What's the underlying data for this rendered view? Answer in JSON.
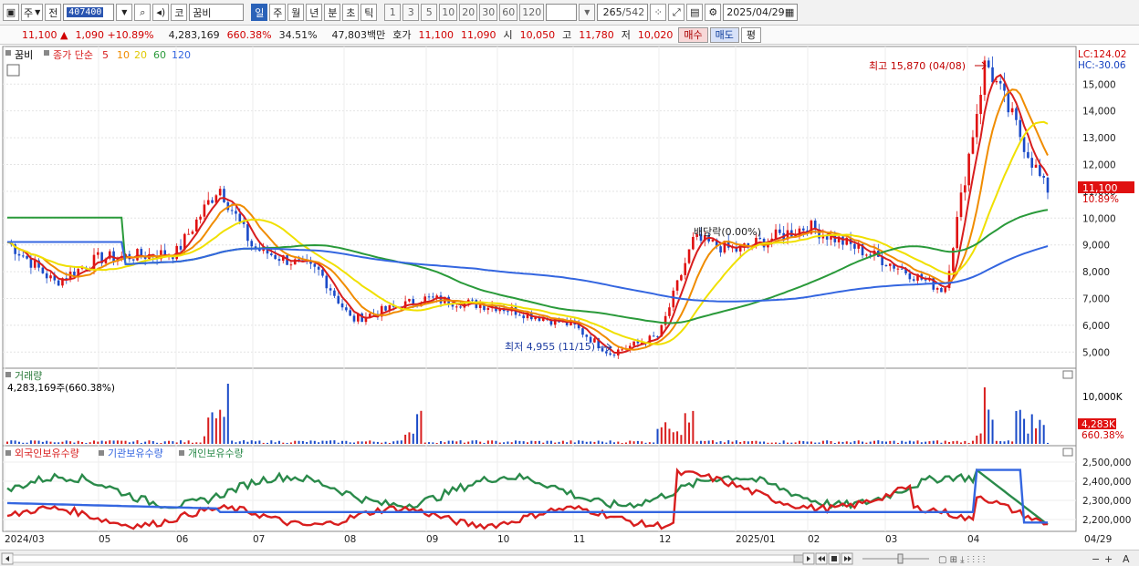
{
  "toolbar": {
    "type_label": "주",
    "prev_label": "전",
    "code": "407400",
    "market_label": "코",
    "stock_name": "꿈비",
    "periods": [
      "일",
      "주",
      "월",
      "년",
      "분",
      "초",
      "틱"
    ],
    "active_period": "일",
    "intervals": [
      "1",
      "3",
      "5",
      "10",
      "20",
      "30",
      "60",
      "120"
    ],
    "count": "265",
    "total": "/542",
    "date": "2025/04/29"
  },
  "quote": {
    "price": "11,100",
    "arrow": "▲",
    "change": "1,090",
    "change_pct": "+10.89%",
    "volume": "4,283,169",
    "volume_pct": "660.38%",
    "turnover": "34.51%",
    "amount": "47,803백만",
    "ask_label": "호가",
    "ask": "11,100",
    "bid": "11,090",
    "open_label": "시",
    "open": "10,050",
    "high_label": "고",
    "high": "11,780",
    "low_label": "저",
    "low": "10,020",
    "buy_label": "매수",
    "sell_label": "매도",
    "eval_label": "평"
  },
  "chart_data": {
    "type": "line",
    "stock": "꿈비",
    "legend_price": "종가 단순",
    "ma_periods": [
      "5",
      "10",
      "20",
      "60",
      "120"
    ],
    "ma_colors": [
      "#d81e1e",
      "#f08c00",
      "#f0e000",
      "#2a9a3a",
      "#3466e0"
    ],
    "price_ticks": [
      "15,000",
      "14,000",
      "13,000",
      "12,000",
      "11,000",
      "10,000",
      "9,000",
      "8,000",
      "7,000",
      "6,000",
      "5,000"
    ],
    "price_range": [
      4500,
      16200
    ],
    "lc_label": "LC:124.02",
    "hc_label": "HC:-30.06",
    "current_price_label": "11,100",
    "current_pct_label": "10.89%",
    "max_annotation": "최고 15,870 (04/08)",
    "min_annotation": "최저 4,955 (11/15)",
    "event_annotation": "배당락(0.00%)",
    "x_labels": [
      "2024/03",
      "05",
      "06",
      "07",
      "08",
      "09",
      "10",
      "11",
      "12",
      "2025/01",
      "02",
      "03",
      "04",
      "04/29"
    ],
    "price_keypoints": [
      {
        "d": "2024/03",
        "v": 9200
      },
      {
        "d": "04",
        "v": 7600
      },
      {
        "d": "05",
        "v": 8500
      },
      {
        "d": "06",
        "v": 8700
      },
      {
        "d": "06/20",
        "v": 11200
      },
      {
        "d": "07",
        "v": 8900
      },
      {
        "d": "08",
        "v": 8000
      },
      {
        "d": "08/05",
        "v": 6200
      },
      {
        "d": "09",
        "v": 7000
      },
      {
        "d": "10",
        "v": 6700
      },
      {
        "d": "11",
        "v": 6000
      },
      {
        "d": "11/15",
        "v": 4955
      },
      {
        "d": "12",
        "v": 5600
      },
      {
        "d": "12/10",
        "v": 9200
      },
      {
        "d": "2025/01",
        "v": 8800
      },
      {
        "d": "02",
        "v": 9700
      },
      {
        "d": "03",
        "v": 8400
      },
      {
        "d": "03/25",
        "v": 7300
      },
      {
        "d": "04/08",
        "v": 15870
      },
      {
        "d": "04/29",
        "v": 11100
      }
    ],
    "volume_panel": {
      "title": "거래량",
      "info": "4,283,169주(660.38%)",
      "tick": "10,000K",
      "current_label": "4,283K",
      "current_pct": "660.38%"
    },
    "holdings_panel": {
      "series": [
        "외국인보유수량",
        "기관보유수량",
        "개인보유수량"
      ],
      "series_colors": [
        "#d81e1e",
        "#3466e0",
        "#2a8a4a"
      ],
      "ticks": [
        "2,500,000",
        "2,400,000",
        "2,300,000",
        "2,200,000"
      ]
    }
  }
}
